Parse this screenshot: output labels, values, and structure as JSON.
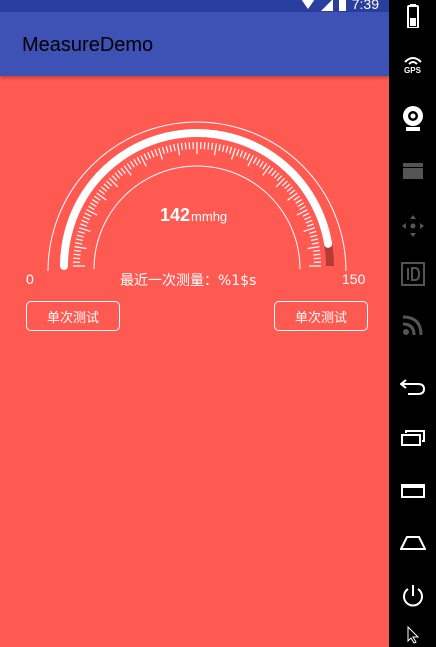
{
  "status_bar": {
    "time": "7:39"
  },
  "app": {
    "title": "MeasureDemo"
  },
  "gauge": {
    "value": "142",
    "unit": "mmhg",
    "min_label": "0",
    "max_label": "150",
    "min": 0,
    "max": 150,
    "current": 142,
    "last_measure_label": "最近一次测量：%1$s"
  },
  "buttons": {
    "left_label": "单次测试",
    "right_label": "单次测试"
  },
  "side_panel": {
    "gps_label": "GPS"
  },
  "colors": {
    "background": "#FF5A52",
    "app_bar": "#3E51B5",
    "status_bar": "#2A3E9E",
    "gauge_progress": "#B83A36"
  }
}
